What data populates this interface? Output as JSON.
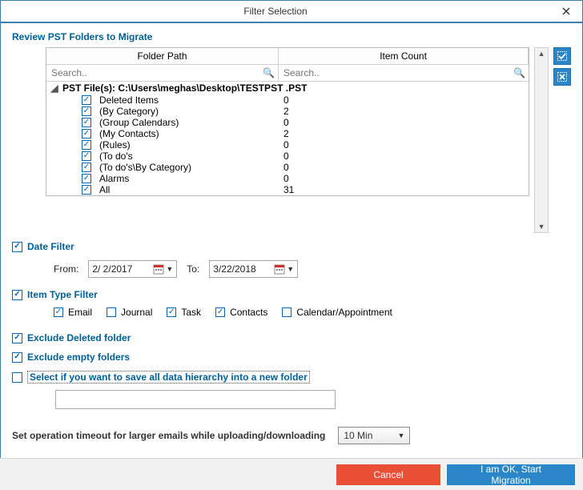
{
  "window": {
    "title": "Filter Selection"
  },
  "section_head": "Review PST Folders to Migrate",
  "grid": {
    "col_path": "Folder Path",
    "col_count": "Item Count",
    "search_placeholder": "Search..",
    "root_label": "PST File(s): C:\\Users\\meghas\\Desktop\\TESTPST .PST",
    "rows": [
      {
        "name": "Deleted Items",
        "count": "0"
      },
      {
        "name": "(By Category)",
        "count": "2"
      },
      {
        "name": "(Group Calendars)",
        "count": "0"
      },
      {
        "name": "(My Contacts)",
        "count": "2"
      },
      {
        "name": "(Rules)",
        "count": "0"
      },
      {
        "name": "(To do's",
        "count": "0"
      },
      {
        "name": "(To do's\\By Category)",
        "count": "0"
      },
      {
        "name": "Alarms",
        "count": "0"
      },
      {
        "name": "All",
        "count": "31"
      }
    ]
  },
  "date_filter": {
    "label": "Date Filter",
    "from_label": "From:",
    "from_value": "2/ 2/2017",
    "to_label": "To:",
    "to_value": "3/22/2018"
  },
  "item_type": {
    "label": "Item Type Filter",
    "email": "Email",
    "journal": "Journal",
    "task": "Task",
    "contacts": "Contacts",
    "calendar": "Calendar/Appointment"
  },
  "exclude_deleted": "Exclude Deleted folder",
  "exclude_empty": "Exclude empty folders",
  "save_hierarchy": "Select if you want to save all data hierarchy into a new folder",
  "timeout": {
    "label": "Set operation timeout for larger emails while uploading/downloading",
    "value": "10 Min"
  },
  "buttons": {
    "cancel": "Cancel",
    "start": "I am OK, Start Migration"
  }
}
